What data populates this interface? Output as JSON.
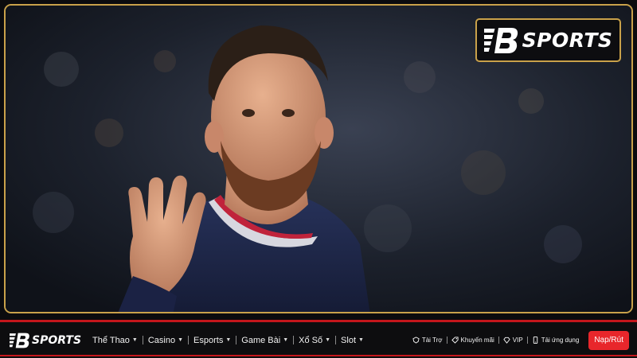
{
  "brand": {
    "name": "SPORTS",
    "logo_mark": "B",
    "accent_gold": "#c9a14a",
    "accent_red": "#e8262b"
  },
  "hero": {
    "image_subject": "football-player-waving"
  },
  "nav": {
    "items": [
      {
        "label": "Thể Thao"
      },
      {
        "label": "Casino"
      },
      {
        "label": "Esports"
      },
      {
        "label": "Game Bài"
      },
      {
        "label": "Xổ Số"
      },
      {
        "label": "Slot"
      }
    ],
    "utility": [
      {
        "label": "Tài Trợ",
        "icon": "sponsor-icon"
      },
      {
        "label": "Khuyến mãi",
        "icon": "tag-icon"
      },
      {
        "label": "VIP",
        "icon": "diamond-icon"
      },
      {
        "label": "Tải ứng dụng",
        "icon": "phone-icon"
      }
    ],
    "cta_label": "Nạp/Rút"
  }
}
